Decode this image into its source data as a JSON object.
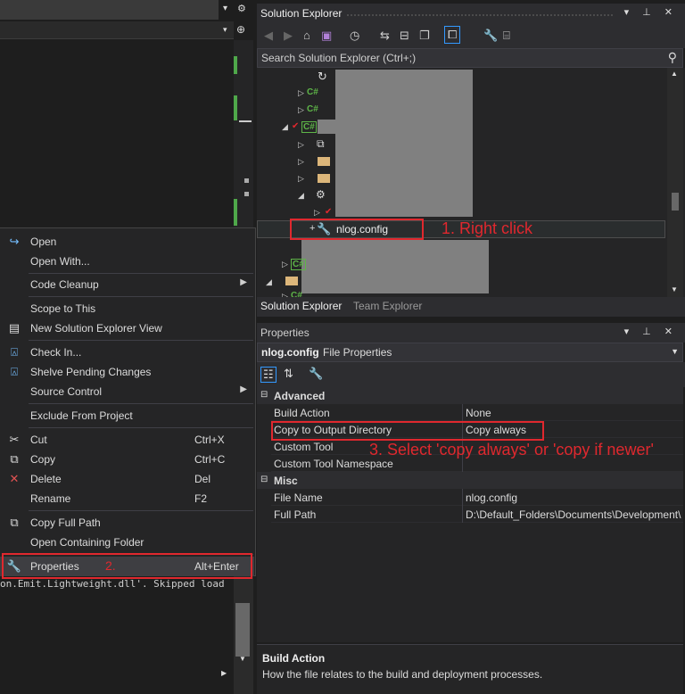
{
  "solution_explorer": {
    "title": "Solution Explorer",
    "search_placeholder": "Search Solution Explorer (Ctrl+;)",
    "selected_item": "nlog.config",
    "tabs": [
      "Solution Explorer",
      "Team Explorer"
    ]
  },
  "annotations": {
    "right_click": "1. Right click",
    "properties": "2.",
    "select": "3. Select 'copy always' or 'copy if newer'"
  },
  "context_menu": {
    "items": [
      {
        "label": "Open",
        "icon": "open-icon"
      },
      {
        "label": "Open With...",
        "icon": ""
      },
      {
        "label": "Code Cleanup",
        "submenu": true
      },
      {
        "label": "Scope to This"
      },
      {
        "label": "New Solution Explorer View",
        "icon": "new-view-icon"
      },
      {
        "label": "Check In...",
        "icon": "check-in-icon"
      },
      {
        "label": "Shelve Pending Changes",
        "icon": "shelve-icon"
      },
      {
        "label": "Source Control",
        "submenu": true
      },
      {
        "label": "Exclude From Project"
      },
      {
        "label": "Cut",
        "shortcut": "Ctrl+X",
        "icon": "cut-icon"
      },
      {
        "label": "Copy",
        "shortcut": "Ctrl+C",
        "icon": "copy-icon"
      },
      {
        "label": "Delete",
        "shortcut": "Del",
        "icon": "delete-icon"
      },
      {
        "label": "Rename",
        "shortcut": "F2"
      },
      {
        "label": "Copy Full Path",
        "icon": "copy-path-icon"
      },
      {
        "label": "Open Containing Folder"
      },
      {
        "label": "Properties",
        "shortcut": "Alt+Enter",
        "icon": "wrench-icon"
      }
    ]
  },
  "properties": {
    "title": "Properties",
    "object_name": "nlog.config",
    "object_kind": "File Properties",
    "categories": [
      {
        "name": "Advanced",
        "rows": [
          {
            "key": "Build Action",
            "value": "None"
          },
          {
            "key": "Copy to Output Directory",
            "value": "Copy always"
          },
          {
            "key": "Custom Tool",
            "value": ""
          },
          {
            "key": "Custom Tool Namespace",
            "value": ""
          }
        ]
      },
      {
        "name": "Misc",
        "rows": [
          {
            "key": "File Name",
            "value": "nlog.config"
          },
          {
            "key": "Full Path",
            "value": "D:\\Default_Folders\\Documents\\Development\\"
          }
        ]
      }
    ],
    "description_title": "Build Action",
    "description_text": "How the file relates to the build and deployment processes."
  },
  "output": {
    "line": "on.Emit.Lightweight.dll'. Skipped load"
  },
  "colors": {
    "annotation": "#e0282e",
    "background": "#1e1e1e",
    "panel": "#252526",
    "csharp": "#5eb548"
  }
}
